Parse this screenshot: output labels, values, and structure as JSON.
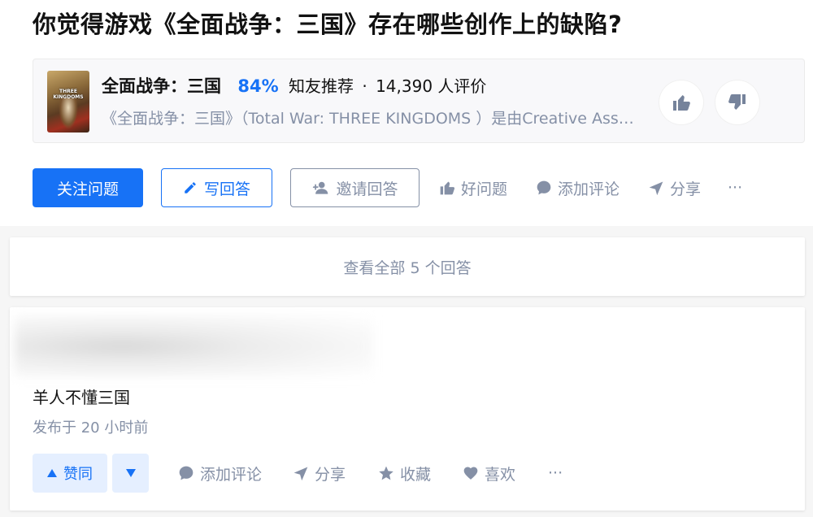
{
  "question": {
    "title": "你觉得游戏《全面战争：三国》存在哪些创作上的缺陷?"
  },
  "game_card": {
    "cover_text": "THREE KINGDOMS",
    "name": "全面战争：三国",
    "percent": "84%",
    "recommend_label": "知友推荐",
    "separator": "·",
    "rating_count": "14,390 人评价",
    "description": "《全面战争：三国》（Total War: THREE KINGDOMS ）是由Creative Assembly开发"
  },
  "actions": {
    "follow_label": "关注问题",
    "write_label": "写回答",
    "invite_label": "邀请回答",
    "good_question_label": "好问题",
    "comment_label": "添加评论",
    "share_label": "分享",
    "more_label": "···"
  },
  "view_all": {
    "label": "查看全部 5 个回答"
  },
  "answer": {
    "text": "羊人不懂三国",
    "time": "发布于 20 小时前",
    "agree_label": "赞同",
    "comment_label": "添加评论",
    "share_label": "分享",
    "collect_label": "收藏",
    "like_label": "喜欢",
    "more_label": "···"
  },
  "colors": {
    "accent": "#1772f6",
    "muted": "#8590a6",
    "vote_bg": "#e5efff"
  }
}
